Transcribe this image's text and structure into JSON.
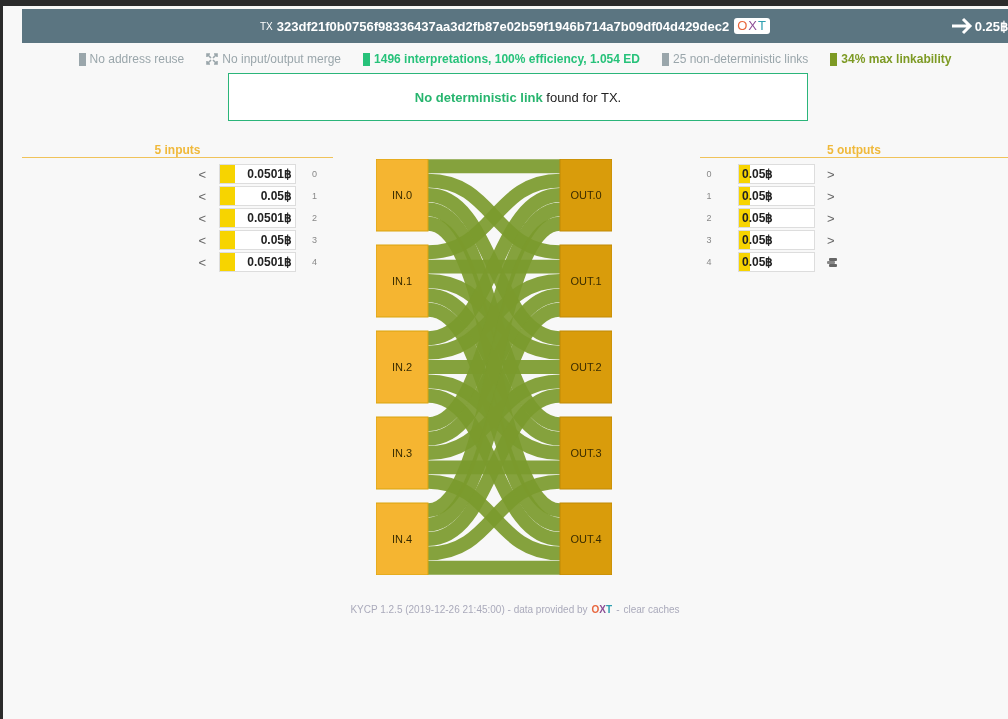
{
  "header": {
    "prefix": "TX",
    "txid": "323df21f0b0756f98336437aa3d2fb87e02b59f1946b714a7b09df04d429dec2",
    "badge": [
      {
        "text": "O",
        "color": "#e8663d"
      },
      {
        "text": "X",
        "color": "#8c4f96"
      },
      {
        "text": "T",
        "color": "#2e9fb0"
      }
    ],
    "total": "0.25฿"
  },
  "flags": [
    {
      "kind": "square",
      "text": "No address reuse",
      "color": "#9aa6ab",
      "highlighted": false
    },
    {
      "kind": "cross-icon",
      "text": "No input/output merge",
      "color": "#9aa6ab",
      "highlighted": false
    },
    {
      "kind": "square",
      "text": "1496 interpretations, 100% efficiency, 1.054 ED",
      "color": "#27c27a",
      "highlighted": true
    },
    {
      "kind": "square",
      "text": "25 non-deterministic links",
      "color": "#9aa6ab",
      "highlighted": false
    },
    {
      "kind": "square",
      "text": "34% max linkability",
      "color": "#7d9a24",
      "highlighted": true
    }
  ],
  "message": "**No deterministic link** found for TX.",
  "inputs": {
    "title": "5 inputs",
    "rows": [
      {
        "arrow": "<",
        "amount": "0.0501฿",
        "index": "0",
        "level": 0.2
      },
      {
        "arrow": "<",
        "amount": "0.05฿",
        "index": "1",
        "level": 0.2
      },
      {
        "arrow": "<",
        "amount": "0.0501฿",
        "index": "2",
        "level": 0.2
      },
      {
        "arrow": "<",
        "amount": "0.05฿",
        "index": "3",
        "level": 0.2
      },
      {
        "arrow": "<",
        "amount": "0.0501฿",
        "index": "4",
        "level": 0.2
      }
    ]
  },
  "outputs": {
    "title": "5 outputs",
    "rows": [
      {
        "kind": "arrow",
        "arrow": ">",
        "amount": "0.05฿",
        "index": "0",
        "level": 0.15
      },
      {
        "kind": "arrow",
        "arrow": ">",
        "amount": "0.05฿",
        "index": "1",
        "level": 0.15
      },
      {
        "kind": "arrow",
        "arrow": ">",
        "amount": "0.05฿",
        "index": "2",
        "level": 0.15
      },
      {
        "kind": "arrow",
        "arrow": ">",
        "amount": "0.05฿",
        "index": "3",
        "level": 0.15
      },
      {
        "kind": "icon",
        "amount": "0.05฿",
        "index": "4",
        "level": 0.15
      }
    ]
  },
  "diagram": {
    "inputs": [
      "IN.0",
      "IN.1",
      "IN.2",
      "IN.3",
      "IN.4"
    ],
    "outputs": [
      "OUT.0",
      "OUT.1",
      "OUT.2",
      "OUT.3",
      "OUT.4"
    ]
  },
  "footer": {
    "version": "KYCP 1.2.5 (2019-12-26 21:45:00) - data provided by",
    "link": [
      {
        "text": "O",
        "color": "#e8663d"
      },
      {
        "text": "X",
        "color": "#8c4f96"
      },
      {
        "text": "T",
        "color": "#2e9fb0"
      }
    ],
    "sep": "-",
    "action": "clear caches"
  }
}
